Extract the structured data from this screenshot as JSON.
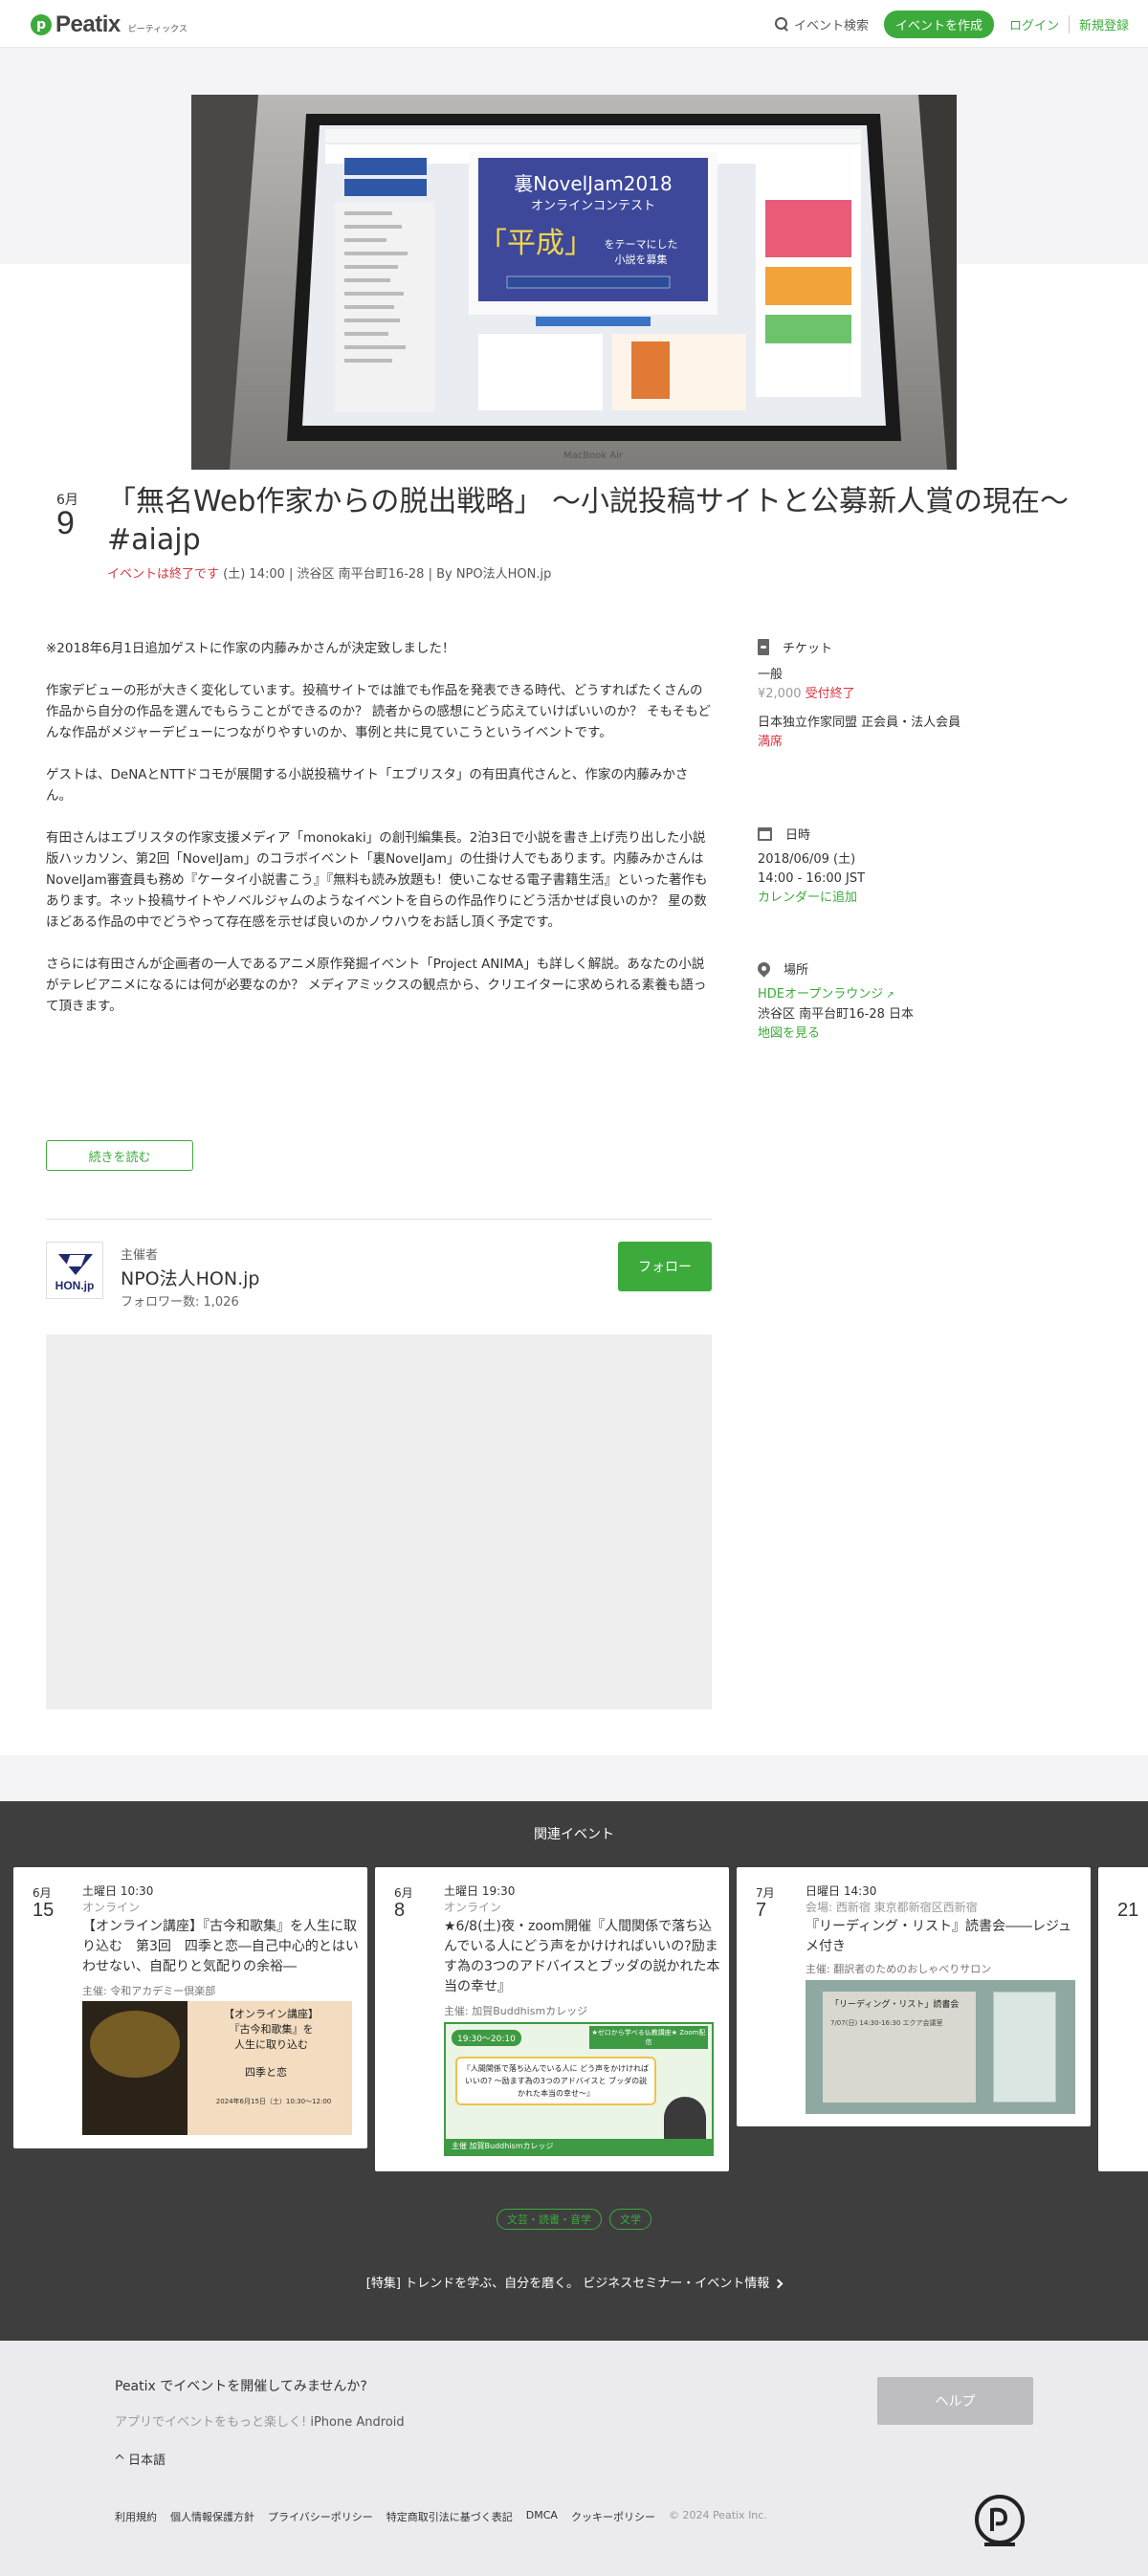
{
  "header": {
    "logo_text": "Peatix",
    "logo_sub": "ピーティックス",
    "search_label": "イベント検索",
    "create_label": "イベントを作成",
    "login_label": "ログイン",
    "signup_label": "新規登録"
  },
  "event": {
    "month": "6月",
    "day": "9",
    "title": "「無名Web作家からの脱出戦略」 〜小説投稿サイトと公募新人賞の現在〜 #aiajp",
    "status": "イベントは終了です",
    "meta": " (土) 14:00 | 渋谷区 南平台町16-28 | By NPO法人HON.jp"
  },
  "description": [
    "※2018年6月1日追加ゲストに作家の内藤みかさんが決定致しました！",
    "作家デビューの形が大きく変化しています。投稿サイトでは誰でも作品を発表できる時代、どうすればたくさんの作品から自分の作品を選んでもらうことができるのか？ 読者からの感想にどう応えていけばいいのか？ そもそもどんな作品がメジャーデビューにつながりやすいのか、事例と共に見ていこうというイベントです。",
    "ゲストは、DeNAとNTTドコモが展開する小説投稿サイト「エブリスタ」の有田真代さんと、作家の内藤みかさん。",
    "有田さんはエブリスタの作家支援メディア「monokaki」の創刊編集長。2泊3日で小説を書き上げ売り出した小説版ハッカソン、第2回「NovelJam」のコラボイベント「裏NovelJam」の仕掛け人でもあります。内藤みかさんはNovelJam審査員も務め『ケータイ小説書こう』『無料も読み放題も！使いこなせる電子書籍生活』といった著作もあります。ネット投稿サイトやノベルジャムのようなイベントを自らの作品作りにどう活かせば良いのか？ 星の数ほどある作品の中でどうやって存在感を示せば良いのかノウハウをお話し頂く予定です。",
    "さらには有田さんが企画者の一人であるアニメ原作発掘イベント「Project ANIMA」も詳しく解説。あなたの小説がテレビアニメになるには何が必要なのか？ メディアミックスの観点から、クリエイターに求められる素養も語って頂きます。"
  ],
  "read_more": "続きを読む",
  "organizer": {
    "logo_text": "HON.jp",
    "label": "主催者",
    "name": "NPO法人HON.jp",
    "followers": "フォロワー数: 1,026",
    "follow_label": "フォロー"
  },
  "sidebar": {
    "ticket_heading": "チケット",
    "ticket_type": "一般",
    "ticket_price": "¥2,000",
    "ticket_status": "受付終了",
    "member_type": "日本独立作家同盟 正会員・法人会員",
    "member_status": "満席",
    "date_heading": "日時",
    "date_line": "2018/06/09 (土)",
    "time_line": "14:00 - 16:00 JST",
    "add_calendar": "カレンダーに追加",
    "place_heading": "場所",
    "venue": "HDEオープンラウンジ",
    "address": "渋谷区 南平台町16-28 日本",
    "map_link": "地図を見る"
  },
  "related": {
    "heading": "関連イベント",
    "cards": [
      {
        "month": "6月",
        "day": "15",
        "when": "土曜日 10:30",
        "where": "オンライン",
        "title": "【オンライン講座】『古今和歌集』を人生に取り込む　第3回　四季と恋―自己中心的とはいわせない、自配りと気配りの余裕―",
        "org": "主催: 令和アカデミー倶楽部",
        "img_title": "【オンライン講座】\n『古今和歌集』を\n人生に取り込む",
        "img_sub": "四季と恋",
        "img_caption": "2024年6月15日（土）10:30〜12:00"
      },
      {
        "month": "6月",
        "day": "8",
        "when": "土曜日 19:30",
        "where": "オンライン",
        "title": "★6/8(土)夜・zoom開催『人間関係で落ち込んでいる人にどう声をかけければいいの?励ます為の3つのアドバイスとブッダの説かれた本当の幸せ』",
        "org": "主催: 加賀Buddhismカレッジ",
        "img_time": "19:30〜20:10",
        "img_badge": "★ゼロから学べる仏教講座★ Zoom配信",
        "img_quote": "『人間関係で落ち込んでいる人に どう声をかけければいいの? ～励ます為の3つのアドバイスと ブッダの説かれた本当の幸せ～』",
        "img_footer": "主催 加賀Buddhismカレッジ"
      },
      {
        "month": "7月",
        "day": "7",
        "when": "日曜日 14:30",
        "where": "会場: 西新宿 東京都新宿区西新宿",
        "title": "『リーディング・リスト』読書会――レジュメ付き",
        "org": "主催: 翻訳者のためのおしゃべりサロン",
        "img_title": "「リーディング・リスト」読書会",
        "img_caption": "7/07(日) 14:30-16:30 エクア会議室"
      },
      {
        "month": "",
        "day": "21"
      }
    ],
    "tags": [
      "文芸・読書・音学",
      "文学"
    ],
    "feature_prefix": "[特集]",
    "feature_text": " トレンドを学ぶ、自分を磨く。 ビジネスセミナー・イベント情報"
  },
  "footer": {
    "question": "Peatix でイベントを開催してみませんか?",
    "apps_prefix": "アプリでイベントをもっと楽しく! ",
    "app_iphone": "iPhone",
    "app_android": "Android",
    "help_label": "ヘルプ",
    "language": "日本語",
    "links": [
      "利用規約",
      "個人情報保護方針",
      "プライバシーポリシー",
      "特定商取引法に基づく表記",
      "DMCA",
      "クッキーポリシー"
    ],
    "copyright": "© 2024 Peatix Inc."
  },
  "colors": {
    "brand": "#3cab3c",
    "ended": "#d9363e",
    "related_bg": "#3e3e3e"
  }
}
